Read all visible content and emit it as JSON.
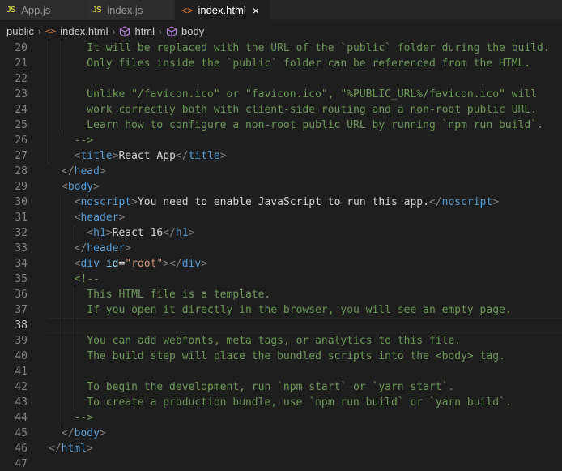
{
  "tabs": [
    {
      "icon": "JS",
      "label": "App.js",
      "active": false
    },
    {
      "icon": "JS",
      "label": "index.js",
      "active": false
    },
    {
      "icon": "<>",
      "label": "index.html",
      "active": true,
      "close": "×"
    }
  ],
  "breadcrumb": {
    "folder": "public",
    "file": "index.html",
    "html_icon": "<>",
    "element1": "html",
    "element2": "body",
    "sep": "›"
  },
  "editor": {
    "current_line": 38,
    "lines": [
      {
        "n": "20",
        "indent": 0,
        "tokens": [
          [
            "c-comment",
            "    It will be replaced with the URL of the `public` folder during the build."
          ]
        ]
      },
      {
        "n": "21",
        "indent": 0,
        "tokens": [
          [
            "c-comment",
            "    Only files inside the `public` folder can be referenced from the HTML."
          ]
        ]
      },
      {
        "n": "22",
        "indent": 0,
        "tokens": []
      },
      {
        "n": "23",
        "indent": 0,
        "tokens": [
          [
            "c-comment",
            "    Unlike \"/favicon.ico\" or \"favicon.ico\", \"%PUBLIC_URL%/favicon.ico\" will"
          ]
        ]
      },
      {
        "n": "24",
        "indent": 0,
        "tokens": [
          [
            "c-comment",
            "    work correctly both with client-side routing and a non-root public URL."
          ]
        ]
      },
      {
        "n": "25",
        "indent": 0,
        "tokens": [
          [
            "c-comment",
            "    Learn how to configure a non-root public URL by running `npm run build`."
          ]
        ]
      },
      {
        "n": "26",
        "indent": 0,
        "tokens": [
          [
            "c-comment",
            "  -->"
          ]
        ]
      },
      {
        "n": "27",
        "indent": 0,
        "tokens": [
          [
            "c-text",
            "  "
          ],
          [
            "c-punc",
            "<"
          ],
          [
            "c-tag",
            "title"
          ],
          [
            "c-punc",
            ">"
          ],
          [
            "c-text",
            "React App"
          ],
          [
            "c-punc",
            "</"
          ],
          [
            "c-tag",
            "title"
          ],
          [
            "c-punc",
            ">"
          ]
        ]
      },
      {
        "n": "28",
        "indent": 0,
        "tokens": [
          [
            "c-punc",
            "</"
          ],
          [
            "c-tag",
            "head"
          ],
          [
            "c-punc",
            ">"
          ]
        ]
      },
      {
        "n": "29",
        "indent": 0,
        "tokens": [
          [
            "c-punc",
            "<"
          ],
          [
            "c-tag",
            "body"
          ],
          [
            "c-punc",
            ">"
          ]
        ]
      },
      {
        "n": "30",
        "indent": 0,
        "tokens": [
          [
            "c-text",
            "  "
          ],
          [
            "c-punc",
            "<"
          ],
          [
            "c-tag",
            "noscript"
          ],
          [
            "c-punc",
            ">"
          ],
          [
            "c-text",
            "You need to enable JavaScript to run this app."
          ],
          [
            "c-punc",
            "</"
          ],
          [
            "c-tag",
            "noscript"
          ],
          [
            "c-punc",
            ">"
          ]
        ]
      },
      {
        "n": "31",
        "indent": 0,
        "tokens": [
          [
            "c-text",
            "  "
          ],
          [
            "c-punc",
            "<"
          ],
          [
            "c-tag",
            "header"
          ],
          [
            "c-punc",
            ">"
          ]
        ]
      },
      {
        "n": "32",
        "indent": 0,
        "tokens": [
          [
            "c-text",
            "    "
          ],
          [
            "c-punc",
            "<"
          ],
          [
            "c-tag",
            "h1"
          ],
          [
            "c-punc",
            ">"
          ],
          [
            "c-text",
            "React 16"
          ],
          [
            "c-punc",
            "</"
          ],
          [
            "c-tag",
            "h1"
          ],
          [
            "c-punc",
            ">"
          ]
        ]
      },
      {
        "n": "33",
        "indent": 0,
        "tokens": [
          [
            "c-text",
            "  "
          ],
          [
            "c-punc",
            "</"
          ],
          [
            "c-tag",
            "header"
          ],
          [
            "c-punc",
            ">"
          ]
        ]
      },
      {
        "n": "34",
        "indent": 0,
        "tokens": [
          [
            "c-text",
            "  "
          ],
          [
            "c-punc",
            "<"
          ],
          [
            "c-tag",
            "div"
          ],
          [
            "c-text",
            " "
          ],
          [
            "c-attr",
            "id"
          ],
          [
            "c-text",
            "="
          ],
          [
            "c-str",
            "\"root\""
          ],
          [
            "c-punc",
            "></"
          ],
          [
            "c-tag",
            "div"
          ],
          [
            "c-punc",
            ">"
          ]
        ]
      },
      {
        "n": "35",
        "indent": 0,
        "tokens": [
          [
            "c-comment",
            "  <!--"
          ]
        ]
      },
      {
        "n": "36",
        "indent": 0,
        "tokens": [
          [
            "c-comment",
            "    This HTML file is a template."
          ]
        ]
      },
      {
        "n": "37",
        "indent": 0,
        "tokens": [
          [
            "c-comment",
            "    If you open it directly in the browser, you will see an empty page."
          ]
        ]
      },
      {
        "n": "38",
        "indent": 0,
        "tokens": []
      },
      {
        "n": "39",
        "indent": 0,
        "tokens": [
          [
            "c-comment",
            "    You can add webfonts, meta tags, or analytics to this file."
          ]
        ]
      },
      {
        "n": "40",
        "indent": 0,
        "tokens": [
          [
            "c-comment",
            "    The build step will place the bundled scripts into the <body> tag."
          ]
        ]
      },
      {
        "n": "41",
        "indent": 0,
        "tokens": []
      },
      {
        "n": "42",
        "indent": 0,
        "tokens": [
          [
            "c-comment",
            "    To begin the development, run `npm start` or `yarn start`."
          ]
        ]
      },
      {
        "n": "43",
        "indent": 0,
        "tokens": [
          [
            "c-comment",
            "    To create a production bundle, use `npm run build` or `yarn build`."
          ]
        ]
      },
      {
        "n": "44",
        "indent": 0,
        "tokens": [
          [
            "c-comment",
            "  -->"
          ]
        ]
      },
      {
        "n": "45",
        "indent": 0,
        "tokens": [
          [
            "c-punc",
            "</"
          ],
          [
            "c-tag",
            "body"
          ],
          [
            "c-punc",
            ">"
          ]
        ]
      },
      {
        "n": "46",
        "indent": 0,
        "tokens": [
          [
            "c-punc",
            "</"
          ],
          [
            "c-tag",
            "html"
          ],
          [
            "c-punc",
            ">"
          ]
        ]
      },
      {
        "n": "47",
        "indent": 0,
        "tokens": []
      }
    ]
  }
}
